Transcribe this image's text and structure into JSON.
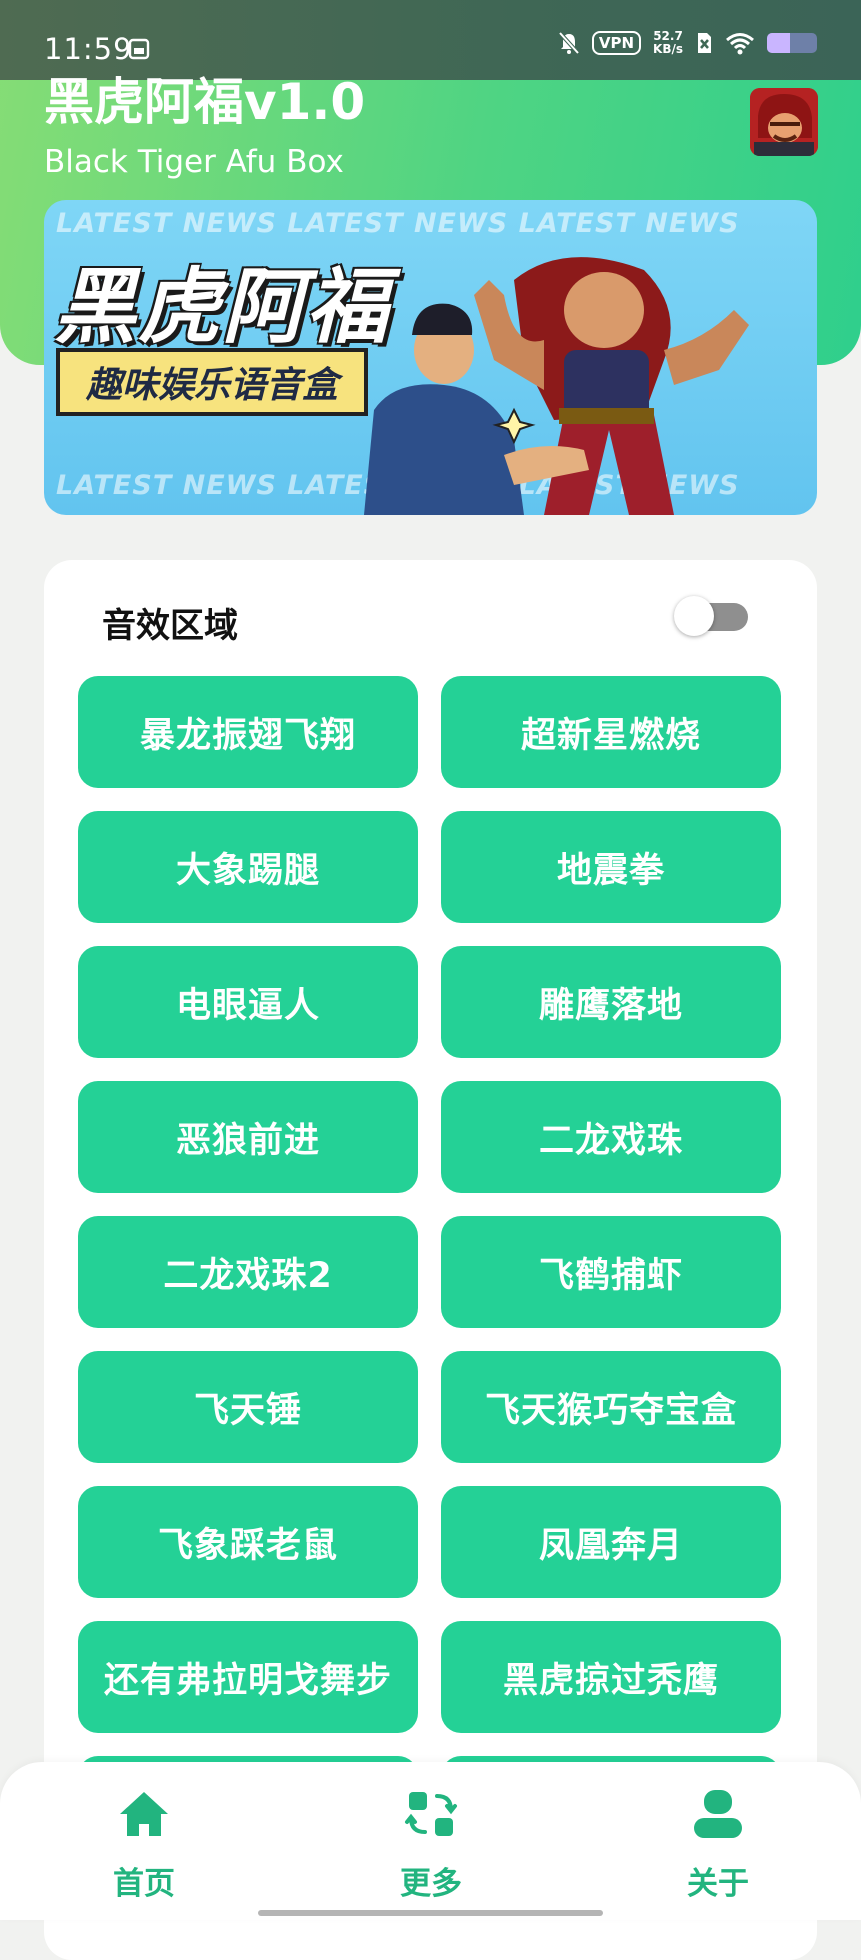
{
  "status_bar": {
    "time": "11:59",
    "vpn": "VPN",
    "speed_value": "52.7",
    "speed_unit": "KB/s",
    "battery_level": 0.45,
    "icons": [
      "sim-card-icon",
      "mute-icon",
      "vpn-icon",
      "wifi-icon",
      "battery-icon"
    ]
  },
  "header": {
    "title": "黑虎阿福v1.0",
    "subtitle": "Black Tiger Afu Box",
    "gradient_colors": [
      "#86dd75",
      "#2fcf8c"
    ]
  },
  "banner": {
    "title": "黑虎阿福",
    "tagline": "趣味娱乐语音盒",
    "news_text": "LATEST NEWS  LATEST NEWS  LATEST NEWS"
  },
  "sound_panel": {
    "title": "音效区域",
    "toggle_on": false,
    "buttons": [
      "暴龙振翅飞翔",
      "超新星燃烧",
      "大象踢腿",
      "地震拳",
      "电眼逼人",
      "雕鹰落地",
      "恶狼前进",
      "二龙戏珠",
      "二龙戏珠2",
      "飞鹤捕虾",
      "飞天锤",
      "飞天猴巧夺宝盒",
      "飞象踩老鼠",
      "凤凰奔月",
      "还有弗拉明戈舞步",
      "黑虎掠过秃鹰",
      "",
      ""
    ],
    "button_color": "#24d196"
  },
  "bottom_nav": {
    "accent_color": "#22b47f",
    "items": [
      {
        "label": "首页",
        "icon": "home-icon"
      },
      {
        "label": "更多",
        "icon": "switch-icon"
      },
      {
        "label": "关于",
        "icon": "user-icon"
      }
    ]
  }
}
